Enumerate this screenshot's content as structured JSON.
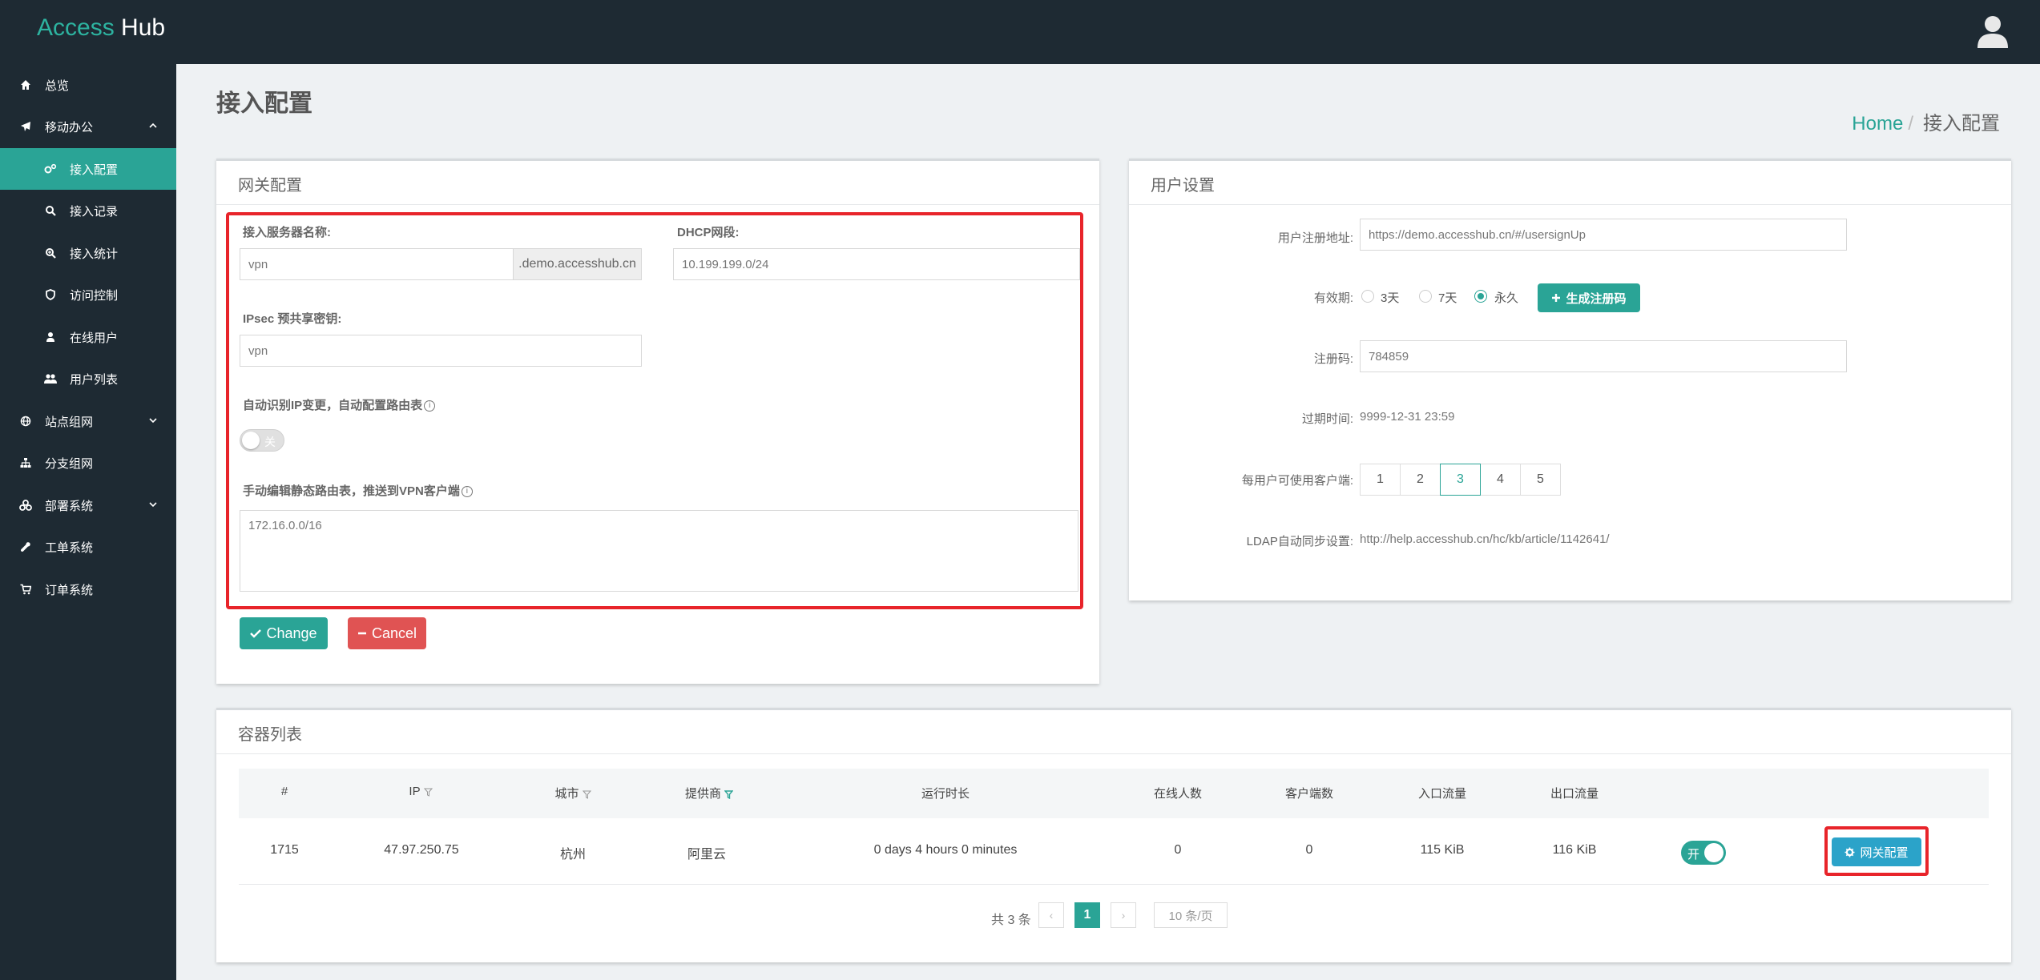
{
  "brand": {
    "part1": "Access",
    "part2": "Hub"
  },
  "colors": {
    "accent": "#2aa496",
    "sidebar": "#1e2a33",
    "danger": "#e05353",
    "info": "#2ba3c9",
    "highlight": "#e8242a"
  },
  "sidebar": {
    "items": [
      {
        "label": "总览",
        "icon": "home-icon"
      },
      {
        "label": "移动办公",
        "icon": "plane-icon"
      },
      {
        "label": "接入配置",
        "icon": "gears-icon"
      },
      {
        "label": "接入记录",
        "icon": "search-icon"
      },
      {
        "label": "接入统计",
        "icon": "zoom-icon"
      },
      {
        "label": "访问控制",
        "icon": "shield-icon"
      },
      {
        "label": "在线用户",
        "icon": "user-icon"
      },
      {
        "label": "用户列表",
        "icon": "users-icon"
      },
      {
        "label": "站点组网",
        "icon": "globe-icon"
      },
      {
        "label": "分支组网",
        "icon": "sitemap-icon"
      },
      {
        "label": "部署系统",
        "icon": "cubes-icon"
      },
      {
        "label": "工单系统",
        "icon": "wrench-icon"
      },
      {
        "label": "订单系统",
        "icon": "cart-icon"
      }
    ]
  },
  "page": {
    "title": "接入配置",
    "breadcrumb": {
      "home": "Home",
      "sep": "/",
      "current": "接入配置"
    }
  },
  "gateway": {
    "title": "网关配置",
    "server_name_label": "接入服务器名称:",
    "server_name_value": "vpn",
    "server_suffix": ".demo.accesshub.cn",
    "dhcp_label": "DHCP网段:",
    "dhcp_value": "10.199.199.0/24",
    "ipsec_label": "IPsec 预共享密钥:",
    "ipsec_value": "vpn",
    "auto_route_label": "自动识别IP变更，自动配置路由表",
    "auto_route_toggle": "关",
    "manual_route_label": "手动编辑静态路由表，推送到VPN客户端",
    "manual_route_value": "172.16.0.0/16",
    "info_glyph": "i",
    "change_label": "Change",
    "cancel_label": "Cancel"
  },
  "user_settings": {
    "title": "用户设置",
    "signup_url_label": "用户注册地址:",
    "signup_url_value": "https://demo.accesshub.cn/#/usersignUp",
    "validity_label": "有效期:",
    "validity_options": [
      "3天",
      "7天",
      "永久"
    ],
    "validity_selected": "永久",
    "generate_label": "生成注册码",
    "code_label": "注册码:",
    "code_value": "784859",
    "expire_label": "过期时间:",
    "expire_value": "9999-12-31 23:59",
    "clients_label": "每用户可使用客户端:",
    "clients_options": [
      "1",
      "2",
      "3",
      "4",
      "5"
    ],
    "clients_selected": "3",
    "ldap_label": "LDAP自动同步设置:",
    "ldap_value": "http://help.accesshub.cn/hc/kb/article/1142641/"
  },
  "containers": {
    "title": "容器列表",
    "columns": [
      "#",
      "IP",
      "城市",
      "提供商",
      "运行时长",
      "在线人数",
      "客户端数",
      "入口流量",
      "出口流量"
    ],
    "rows": [
      {
        "id": "1715",
        "ip": "47.97.250.75",
        "city": "杭州",
        "provider": "阿里云",
        "uptime": "0 days 4 hours 0 minutes",
        "online": "0",
        "clients": "0",
        "in": "115 KiB",
        "out": "116 KiB",
        "switch": "开",
        "action": "网关配置"
      }
    ],
    "pager": {
      "total": "共 3 条",
      "prev": "‹",
      "current": "1",
      "next": "›",
      "size": "10 条/页"
    }
  }
}
